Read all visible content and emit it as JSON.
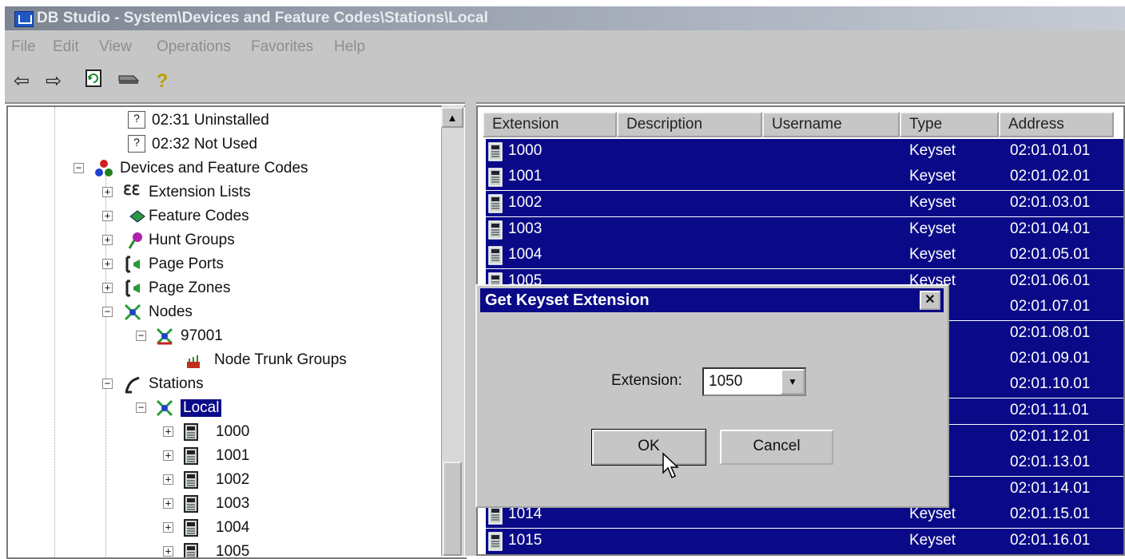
{
  "window": {
    "title": "DB Studio - System\\Devices and Feature Codes\\Stations\\Local"
  },
  "menu": [
    "File",
    "Edit",
    "View",
    "Operations",
    "Favorites",
    "Help"
  ],
  "toolbar": [
    "back-arrow-icon",
    "forward-arrow-icon",
    "refresh-icon",
    "toggle-icon",
    "help-icon"
  ],
  "tree": {
    "items": [
      {
        "label": "02:31 Uninstalled"
      },
      {
        "label": "02:32 Not Used"
      },
      {
        "label": "Devices and Feature Codes"
      },
      {
        "label": "Extension Lists"
      },
      {
        "label": "Feature Codes"
      },
      {
        "label": "Hunt Groups"
      },
      {
        "label": "Page Ports"
      },
      {
        "label": "Page Zones"
      },
      {
        "label": "Nodes"
      },
      {
        "label": "97001"
      },
      {
        "label": "Node Trunk Groups"
      },
      {
        "label": "Stations"
      },
      {
        "label": "Local"
      },
      {
        "label": "1000"
      },
      {
        "label": "1001"
      },
      {
        "label": "1002"
      },
      {
        "label": "1003"
      },
      {
        "label": "1004"
      },
      {
        "label": "1005"
      }
    ]
  },
  "list": {
    "columns": [
      "Extension",
      "Description",
      "Username",
      "Type",
      "Address"
    ],
    "rows": [
      {
        "extension": "1000",
        "type": "Keyset",
        "address": "02:01.01.01"
      },
      {
        "extension": "1001",
        "type": "Keyset",
        "address": "02:01.02.01"
      },
      {
        "extension": "1002",
        "type": "Keyset",
        "address": "02:01.03.01"
      },
      {
        "extension": "1003",
        "type": "Keyset",
        "address": "02:01.04.01"
      },
      {
        "extension": "1004",
        "type": "Keyset",
        "address": "02:01.05.01"
      },
      {
        "extension": "1005",
        "type": "Keyset",
        "address": "02:01.06.01"
      },
      {
        "extension": "",
        "type": "",
        "address": "02:01.07.01"
      },
      {
        "extension": "",
        "type": "",
        "address": "02:01.08.01"
      },
      {
        "extension": "",
        "type": "",
        "address": "02:01.09.01"
      },
      {
        "extension": "",
        "type": "",
        "address": "02:01.10.01"
      },
      {
        "extension": "",
        "type": "",
        "address": "02:01.11.01"
      },
      {
        "extension": "",
        "type": "",
        "address": "02:01.12.01"
      },
      {
        "extension": "",
        "type": "",
        "address": "02:01.13.01"
      },
      {
        "extension": "",
        "type": "",
        "address": "02:01.14.01"
      },
      {
        "extension": "1014",
        "type": "Keyset",
        "address": "02:01.15.01"
      },
      {
        "extension": "1015",
        "type": "Keyset",
        "address": "02:01.16.01"
      }
    ]
  },
  "dialog": {
    "title": "Get Keyset Extension",
    "field_label": "Extension:",
    "field_value": "1050",
    "ok_label": "OK",
    "cancel_label": "Cancel",
    "close_glyph": "✕"
  },
  "colors": {
    "selection": "#0a0a88",
    "chrome": "#c6c6c6"
  }
}
